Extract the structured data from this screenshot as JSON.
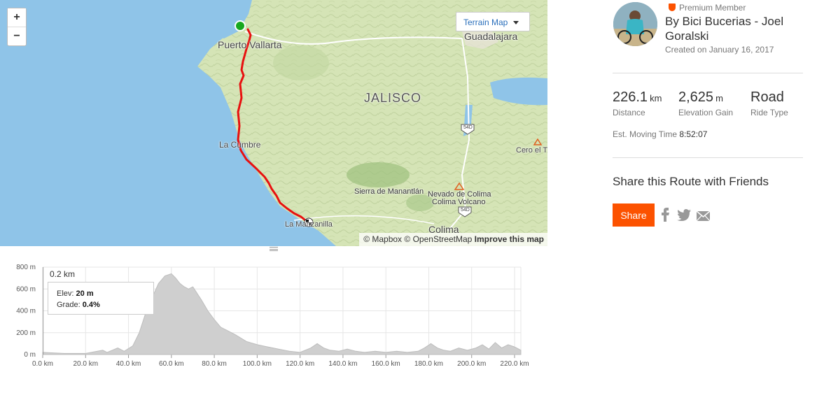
{
  "map": {
    "zoom_in_label": "+",
    "zoom_out_label": "−",
    "terrain_button_label": "Terrain Map",
    "labels": {
      "puerto_vallarta": "Puerto Vallarta",
      "guadalajara": "Guadalajara",
      "jalisco": "JALISCO",
      "la_cumbre": "La Cumbre",
      "cero_el": "Cero el T",
      "sierra": "Sierra de Manantlán",
      "nevado": "Nevado de Colima",
      "colima_volcano": "Colima Volcano",
      "la_manzanilla": "La Manzanilla",
      "colima": "Colima",
      "route_54d_1": "54D",
      "route_54d_2": "54D"
    },
    "attribution": {
      "mapbox": "© Mapbox",
      "osm": "© OpenStreetMap",
      "improve": "Improve this map"
    },
    "colors": {
      "water": "#8fc4e8",
      "land": "#d5e4b6",
      "route": "#e8100f",
      "start": "#18a81e"
    }
  },
  "elevation": {
    "y_ticks": [
      "800 m",
      "600 m",
      "400 m",
      "200 m",
      "0 m"
    ],
    "x_ticks": [
      "0.0 km",
      "20.0 km",
      "40.0 km",
      "60.0 km",
      "80.0 km",
      "100.0 km",
      "120.0 km",
      "140.0 km",
      "160.0 km",
      "180.0 km",
      "200.0 km",
      "220.0 km"
    ],
    "readout_distance": "0.2 km",
    "tooltip": {
      "elev_label": "Elev:",
      "elev_value": "20 m",
      "grade_label": "Grade:",
      "grade_value": "0.4%"
    }
  },
  "chart_data": {
    "type": "area",
    "xlabel": "",
    "ylabel": "",
    "xlim": [
      0,
      226.1
    ],
    "ylim": [
      0,
      800
    ],
    "x": [
      0,
      10,
      20,
      28,
      30,
      35,
      38,
      42,
      45,
      48,
      51,
      54,
      57,
      60,
      62,
      64,
      66,
      68,
      70,
      72,
      74,
      77,
      80,
      83,
      86,
      90,
      95,
      100,
      105,
      110,
      115,
      120,
      125,
      128,
      131,
      134,
      138,
      142,
      146,
      150,
      155,
      160,
      165,
      170,
      175,
      178,
      181,
      184,
      187,
      190,
      194,
      198,
      202,
      205,
      208,
      211,
      214,
      217,
      220,
      223,
      226.1
    ],
    "y": [
      20,
      10,
      10,
      40,
      20,
      60,
      30,
      80,
      200,
      380,
      520,
      650,
      720,
      740,
      700,
      650,
      620,
      600,
      620,
      560,
      500,
      400,
      320,
      250,
      220,
      180,
      120,
      90,
      70,
      50,
      30,
      20,
      60,
      100,
      60,
      40,
      30,
      50,
      30,
      20,
      30,
      20,
      30,
      20,
      30,
      60,
      100,
      60,
      40,
      30,
      60,
      40,
      60,
      90,
      50,
      110,
      60,
      90,
      70,
      40,
      30
    ],
    "grid": true
  },
  "sidebar": {
    "premium_label": "Premium Member",
    "athlete_name": "By Bici Bucerias - Joel Goralski",
    "created": "Created on January 16, 2017",
    "stats": [
      {
        "value": "226.1",
        "unit": "km",
        "label": "Distance"
      },
      {
        "value": "2,625",
        "unit": "m",
        "label": "Elevation Gain"
      },
      {
        "value": "Road",
        "unit": "",
        "label": "Ride Type"
      }
    ],
    "moving_time_label": "Est. Moving Time",
    "moving_time_value": "8:52:07",
    "share_title": "Share this Route with Friends",
    "share_button": "Share",
    "social_icons": [
      "facebook-icon",
      "twitter-icon",
      "email-icon"
    ],
    "accent_color": "#fc5200"
  }
}
